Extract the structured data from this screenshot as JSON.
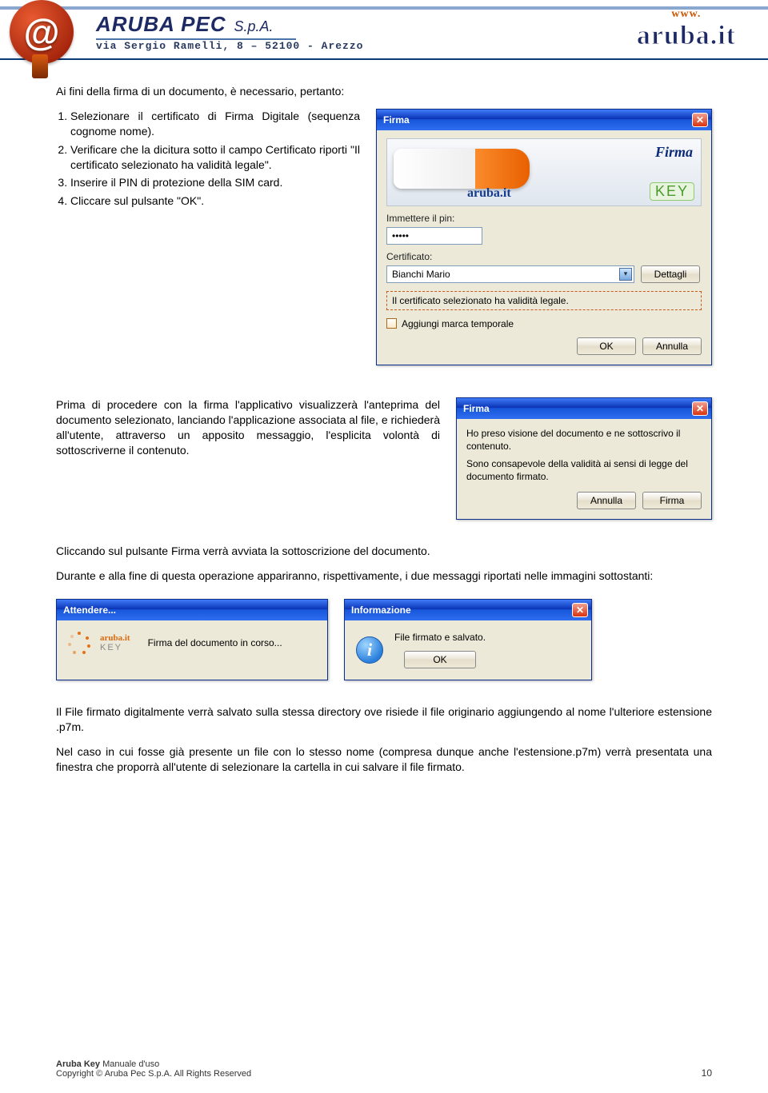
{
  "header": {
    "company": "ARUBA PEC",
    "spa": "S.p.A.",
    "address": "via Sergio Ramelli, 8 – 52100 - Arezzo",
    "www": "www.",
    "logo": "aruba.it"
  },
  "intro": "Ai fini della firma di un documento, è necessario, pertanto:",
  "steps": [
    "Selezionare il certificato di Firma Digitale (sequenza cognome nome).",
    "Verificare che la dicitura sotto il campo Certificato riporti \"Il certificato selezionato ha validità legale\".",
    "Inserire il PIN di protezione della SIM card.",
    "Cliccare sul pulsante \"OK\"."
  ],
  "firma_dialog": {
    "title": "Firma",
    "banner_firma": "Firma",
    "banner_aruba": "aruba.it",
    "banner_key": "KEY",
    "pin_label": "Immettere il pin:",
    "pin_value": "•••••",
    "cert_label": "Certificato:",
    "cert_value": "Bianchi Mario",
    "dettagli": "Dettagli",
    "legal_msg": "Il certificato selezionato ha validità legale.",
    "marca": "Aggiungi marca temporale",
    "ok": "OK",
    "annulla": "Annulla"
  },
  "para2": "Prima di procedere con la firma l'applicativo visualizzerà l'anteprima del documento selezionato, lanciando l'applicazione associata al file, e richiederà all'utente, attraverso un apposito messaggio, l'esplicita volontà di sottoscriverne il contenuto.",
  "confirm_dialog": {
    "title": "Firma",
    "line1": "Ho preso visione del documento e ne sottoscrivo il contenuto.",
    "line2": "Sono consapevole della validità ai sensi di legge del documento firmato.",
    "annulla": "Annulla",
    "firma": "Firma"
  },
  "para3a": "Cliccando sul pulsante Firma verrà avviata la sottoscrizione del documento.",
  "para3b": "Durante e alla fine di questa operazione appariranno, rispettivamente, i due messaggi riportati nelle immagini sottostanti:",
  "attendere_dialog": {
    "title": "Attendere...",
    "arubatt": "aruba.it",
    "key": "KEY",
    "msg": "Firma del documento in corso..."
  },
  "info_dialog": {
    "title": "Informazione",
    "msg": "File firmato e salvato.",
    "ok": "OK"
  },
  "para4": "Il File firmato digitalmente verrà salvato sulla stessa directory ove risiede il file originario aggiungendo al nome l'ulteriore estensione .p7m.",
  "para5": "Nel caso in cui fosse già presente un file con lo stesso nome (compresa dunque anche l'estensione.p7m) verrà presentata una finestra che proporrà all'utente di selezionare la cartella in cui salvare il file firmato.",
  "footer": {
    "l1a": "Aruba Key",
    "l1b": " Manuale d'uso",
    "l2": "Copyright © Aruba Pec S.p.A. All Rights Reserved",
    "page": "10"
  }
}
